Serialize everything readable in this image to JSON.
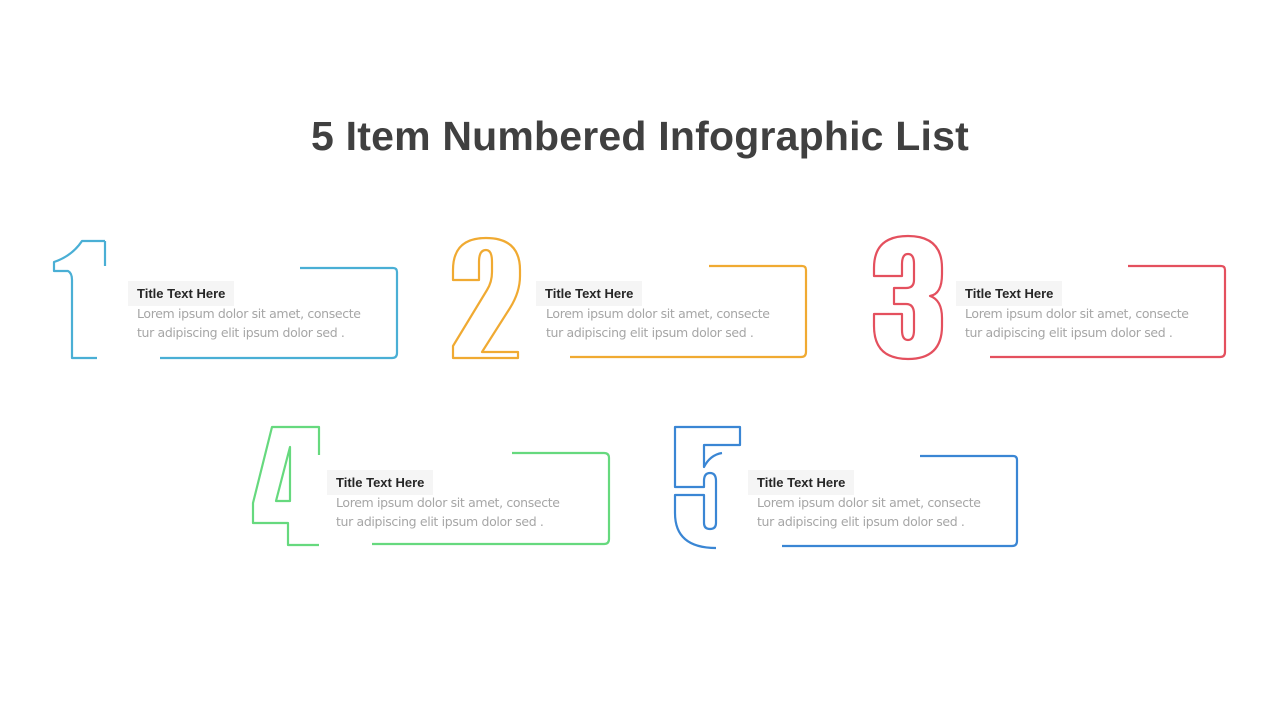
{
  "title": "5 Item Numbered Infographic List",
  "items": [
    {
      "number": "1",
      "title": "Title Text Here",
      "line1": "Lorem ipsum dolor sit amet, consecte",
      "line2": "tur adipiscing elit ipsum dolor sed .",
      "color": "#4aafd5"
    },
    {
      "number": "2",
      "title": "Title Text Here",
      "line1": "Lorem ipsum dolor sit amet, consecte",
      "line2": "tur adipiscing elit ipsum dolor sed .",
      "color": "#f0aa32"
    },
    {
      "number": "3",
      "title": "Title Text Here",
      "line1": "Lorem ipsum dolor sit amet, consecte",
      "line2": "tur adipiscing elit ipsum dolor sed .",
      "color": "#e4505e"
    },
    {
      "number": "4",
      "title": "Title Text Here",
      "line1": "Lorem ipsum dolor sit amet, consecte",
      "line2": "tur adipiscing elit ipsum dolor sed .",
      "color": "#66d97e"
    },
    {
      "number": "5",
      "title": "Title Text Here",
      "line1": "Lorem ipsum dolor sit amet, consecte",
      "line2": "tur adipiscing elit ipsum dolor sed .",
      "color": "#3a86d4"
    }
  ]
}
